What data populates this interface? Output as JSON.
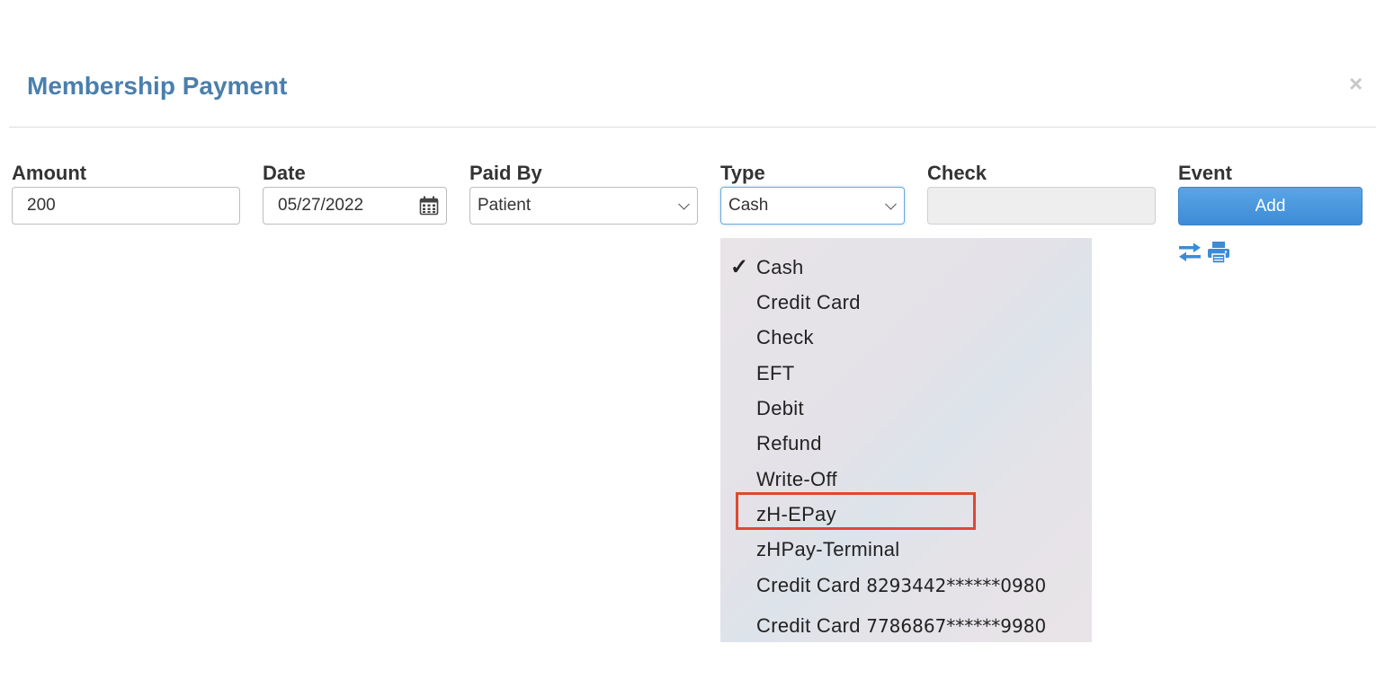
{
  "modal": {
    "title": "Membership Payment",
    "close_glyph": "×"
  },
  "form": {
    "amount": {
      "label": "Amount",
      "value": "200"
    },
    "date": {
      "label": "Date",
      "value": "05/27/2022"
    },
    "paid_by": {
      "label": "Paid By",
      "value": "Patient"
    },
    "type": {
      "label": "Type",
      "value": "Cash"
    },
    "check": {
      "label": "Check",
      "value": ""
    },
    "event": {
      "label": "Event",
      "add_label": "Add"
    }
  },
  "type_dropdown": {
    "options": [
      {
        "label": "Cash",
        "selected": true
      },
      {
        "label": "Credit Card"
      },
      {
        "label": "Check"
      },
      {
        "label": "EFT"
      },
      {
        "label": "Debit"
      },
      {
        "label": "Refund"
      },
      {
        "label": "Write-Off"
      },
      {
        "label": "zH-EPay",
        "highlighted": true
      },
      {
        "label": "zHPay-Terminal"
      },
      {
        "label": "Credit Card",
        "card_number": "8293442******0980"
      },
      {
        "label": "Credit Card",
        "card_number": "7786867******9980"
      }
    ],
    "checkmark": "✓"
  },
  "icons": {
    "transfer": "transfer-icon",
    "print": "print-icon",
    "calendar": "calendar-icon"
  },
  "colors": {
    "title": "#4a7fad",
    "add_button": "#4a97dd",
    "highlight_border": "#e0482f",
    "icon_blue": "#3d8bd6"
  }
}
